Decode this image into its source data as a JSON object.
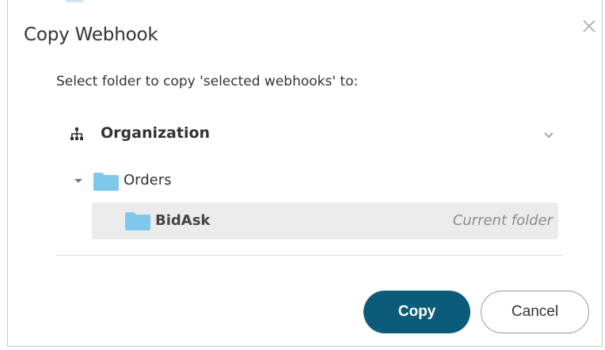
{
  "dialog": {
    "title": "Copy Webhook",
    "close_icon": "close-icon",
    "subtitle": "Select folder to copy 'selected webhooks' to:"
  },
  "tree": {
    "root": {
      "label": "Organization",
      "icon": "hierarchy-icon",
      "expand_icon": "chevron-down-icon"
    },
    "folders": [
      {
        "label": "Orders",
        "icon": "folder-icon",
        "expanded": true,
        "children": [
          {
            "label": "BidAsk",
            "icon": "folder-icon",
            "note": "Current folder",
            "selected": true
          }
        ]
      }
    ]
  },
  "buttons": {
    "copy_label": "Copy",
    "cancel_label": "Cancel"
  },
  "colors": {
    "primary": "#0c5b7b",
    "folder": "#7fc8ec",
    "selected_row": "#ebebeb",
    "text": "#333333",
    "muted": "#8c8c8c"
  }
}
